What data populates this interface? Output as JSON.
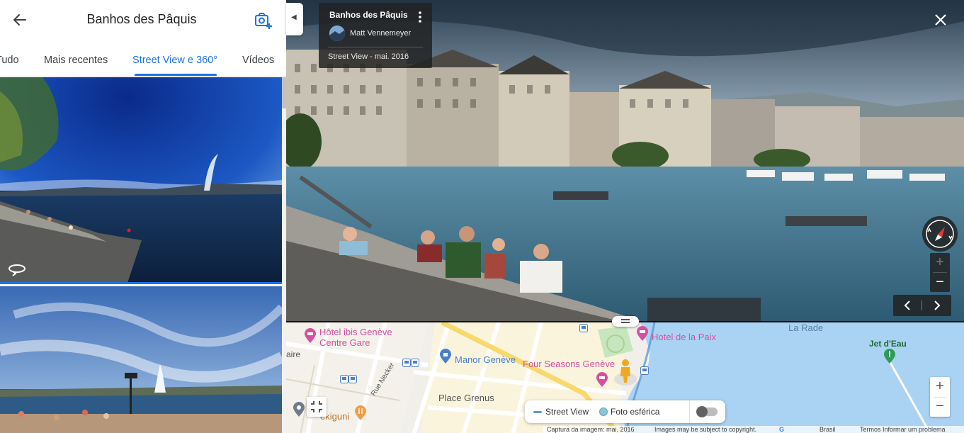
{
  "panel": {
    "title": "Banhos des Pâquis",
    "tabs": [
      {
        "label": "Tudo"
      },
      {
        "label": "Mais recentes"
      },
      {
        "label": "Street View e 360°",
        "active": true
      },
      {
        "label": "Vídeos"
      }
    ]
  },
  "street_view": {
    "place": "Banhos des Pâquis",
    "author": "Matt Vennemeyer",
    "date": "Street View - mai. 2016",
    "zoom_in": "+",
    "zoom_out": "−"
  },
  "map": {
    "labels": {
      "ibis": "Hôtel ibis Genève\nCentre Gare",
      "manor": "Manor Genève",
      "four_seasons": "Four Seasons Genève",
      "hotel_paix": "Hotel de la Paix",
      "la_rade": "La Rade",
      "jet_deau": "Jet d'Eau",
      "place_grenus": "Place Grenus",
      "rue_necker": "Rue Necker",
      "gare": "aire",
      "ekiguni": "ekiguni"
    },
    "zoom_in": "+",
    "zoom_out": "−",
    "legend": {
      "street_view": "Street View",
      "foto_esferica": "Foto esférica"
    },
    "attribution": {
      "capture": "Captura da imagem: mai. 2016",
      "copyright": "Images may be subject to copyright.",
      "country": "Brasil",
      "terms": "Termos",
      "report": "Informar um problema"
    }
  },
  "colors": {
    "accent": "#1a73e8",
    "poi_pink": "#d64fa0",
    "water": "#aad3f3",
    "street_view_line": "#5b9bd8"
  }
}
